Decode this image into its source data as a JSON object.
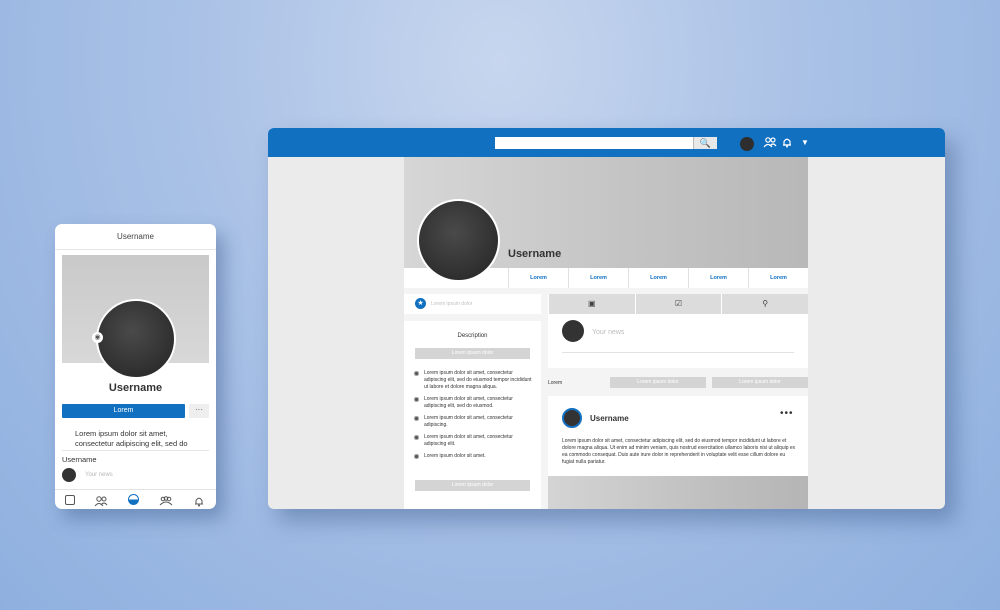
{
  "mobile": {
    "title": "Username",
    "username": "Username",
    "primary_button": "Lorem",
    "more_button": "···",
    "description": "Lorem ipsum dolor sit amet, consectetur adipiscing elit, sed do",
    "section_label": "Username",
    "post_placeholder": "Your news",
    "nav_icons": [
      "square-icon",
      "friends-icon",
      "profile-icon",
      "groups-icon",
      "bell-icon"
    ]
  },
  "desktop": {
    "topbar": {
      "search_icon": "🔍",
      "friends_icon": "⚇",
      "bell_icon": "🔔",
      "caret_icon": "▼"
    },
    "profile": {
      "username": "Username",
      "tabs": [
        "Lorem",
        "Lorem",
        "Lorem",
        "Lorem",
        "Lorem"
      ]
    },
    "status": {
      "placeholder": "Lorem ipsum dolor",
      "star_icon": "★"
    },
    "description": {
      "title": "Description",
      "top_button": "Lorem ipsum dolor",
      "items": [
        "Lorem ipsum dolor sit amet, consectetur adipiscing elit, sed do eiusmod tempor incididunt ut labore et dolore magna aliqua.",
        "Lorem ipsum dolor sit amet, consectetur adipiscing elit, sed do eiusmod.",
        "Lorem ipsum dolor sit amet, consectetur adipiscing.",
        "Lorem ipsum dolor sit amet, consectetur adipiscing elit.",
        "Lorem ipsum dolor sit amet."
      ],
      "bottom_button": "Lorem ipsum dolor"
    },
    "composer": {
      "icons": [
        "▣",
        "☑",
        "⚲"
      ],
      "placeholder": "Your news"
    },
    "filter": {
      "label": "Lorem",
      "button1": "Lorem ipsum dolor",
      "button2": "Lorem ipsum dolor"
    },
    "post": {
      "username": "Username",
      "more": "•••",
      "text": "Lorem ipsum dolor sit amet, consectetur adipiscing elit, sed do eiusmod tempor incididunt ut labore et dolore magna aliqua. Ut enim ad minim veniam, quis nostrud exercitation ullamco laboris nisi ut aliquip ex ea commodo consequat. Duis aute irure dolor in reprehenderit in voluptate velit esse cillum dolore eu fugiat nulla pariatur."
    }
  },
  "colors": {
    "brand": "#1170c0",
    "background": "#a9c1e6"
  }
}
